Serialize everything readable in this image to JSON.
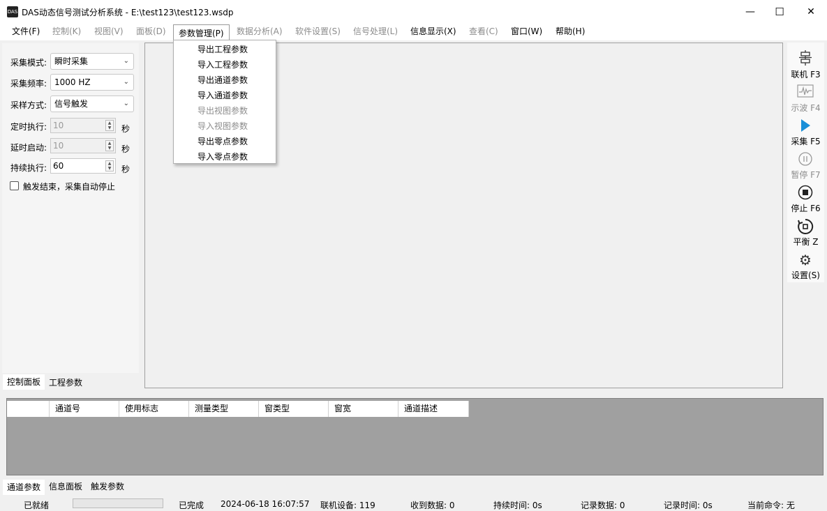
{
  "window": {
    "app_icon_text": "DAS",
    "title": "DAS动态信号测试分析系统 - E:\\test123\\test123.wsdp",
    "minimize_glyph": "—",
    "maximize_glyph": "☐",
    "close_glyph": "✕"
  },
  "menubar": {
    "file": "文件(F)",
    "control": "控制(K)",
    "view": "视图(V)",
    "panel": "面板(D)",
    "params": "参数管理(P)",
    "data_analysis": "数据分析(A)",
    "software_settings": "软件设置(S)",
    "signal_processing": "信号处理(L)",
    "info_display": "信息显示(X)",
    "inspect": "查看(C)",
    "window": "窗口(W)",
    "help": "帮助(H)"
  },
  "dropdown": {
    "items": [
      {
        "label": "导出工程参数",
        "enabled": true
      },
      {
        "label": "导入工程参数",
        "enabled": true
      },
      {
        "label": "导出通道参数",
        "enabled": true
      },
      {
        "label": "导入通道参数",
        "enabled": true
      },
      {
        "label": "导出视图参数",
        "enabled": false
      },
      {
        "label": "导入视图参数",
        "enabled": false
      },
      {
        "label": "导出零点参数",
        "enabled": true
      },
      {
        "label": "导入零点参数",
        "enabled": true
      }
    ]
  },
  "control_panel": {
    "mode_label": "采集模式:",
    "mode_value": "瞬时采集",
    "freq_label": "采集频率:",
    "freq_value": "1000 HZ",
    "sample_label": "采样方式:",
    "sample_value": "信号触发",
    "timed_label": "定时执行:",
    "timed_value": "10",
    "delay_label": "延时启动:",
    "delay_value": "10",
    "duration_label": "持续执行:",
    "duration_value": "60",
    "unit_seconds": "秒",
    "auto_stop_label": "触发结束，采集自动停止",
    "auto_stop_checked": false
  },
  "left_tabs": {
    "control_panel": "控制面板",
    "project_params": "工程参数"
  },
  "toolbar": {
    "connect": "联机 F3",
    "scope": "示波 F4",
    "collect": "采集 F5",
    "pause": "暂停 F7",
    "stop": "停止 F6",
    "balance": "平衡 Z",
    "settings": "设置(S)"
  },
  "toolbar_icons": {
    "connect": "network-icon",
    "scope": "waveform-icon",
    "collect": "play-icon",
    "pause": "pause-icon",
    "stop": "stop-icon",
    "balance": "balance-icon",
    "settings": "gear-icon",
    "accent_color": "#1a8fd8"
  },
  "channel_table": {
    "headers": [
      "",
      "通道号",
      "使用标志",
      "测量类型",
      "窗类型",
      "窗宽",
      "通道描述"
    ]
  },
  "bottom_tabs": {
    "channel_params": "通道参数",
    "info_panel": "信息面板",
    "trigger_params": "触发参数"
  },
  "statusbar": {
    "ready": "已就绪",
    "progress_fraction": 0,
    "done": "已完成",
    "datetime": "2024-06-18 16:07:57",
    "devices": "联机设备: 119",
    "received": "收到数据: 0",
    "duration": "持续时间: 0s",
    "recorded": "记录数据: 0",
    "record_time": "记录时间: 0s",
    "current_cmd": "当前命令: 无"
  }
}
